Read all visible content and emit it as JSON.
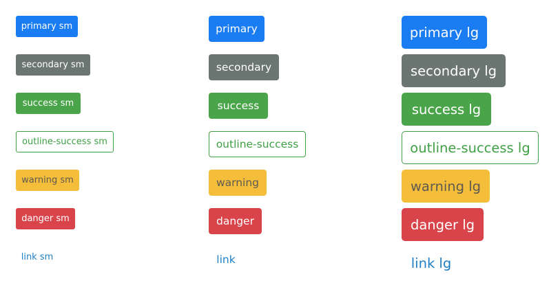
{
  "columns": {
    "small": {
      "primary": "primary sm",
      "secondary": "secondary sm",
      "success": "success sm",
      "outline_success": "outline-success sm",
      "warning": "warning sm",
      "danger": "danger sm",
      "link": "link sm"
    },
    "medium": {
      "primary": "primary",
      "secondary": "secondary",
      "success": "success",
      "outline_success": "outline-success",
      "warning": "warning",
      "danger": "danger",
      "link": "link"
    },
    "large": {
      "primary": "primary lg",
      "secondary": "secondary lg",
      "success": "success lg",
      "outline_success": "outline-success lg",
      "warning": "warning lg",
      "danger": "danger lg",
      "link": "link lg"
    }
  },
  "colors": {
    "primary": "#1a7cf2",
    "secondary": "#6b7571",
    "success": "#4aa54a",
    "outline_success": "#3f9f45",
    "warning": "#f4bd3a",
    "danger": "#d9434a",
    "link": "#1f7fc4"
  }
}
